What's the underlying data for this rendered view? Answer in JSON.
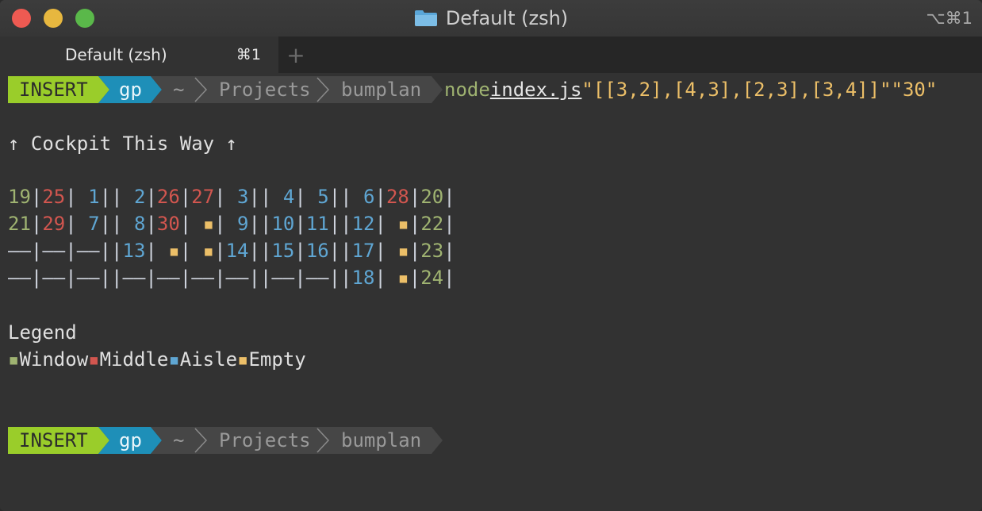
{
  "window": {
    "title": "Default (zsh)",
    "shortcut": "⌥⌘1"
  },
  "tab": {
    "label": "Default (zsh)",
    "shortcut": "⌘1",
    "add": "+"
  },
  "prompt": {
    "mode": "INSERT",
    "user": "gp",
    "home": "~",
    "dir1": "Projects",
    "dir2": "bumplan"
  },
  "command": {
    "program": "node",
    "file": "index.js",
    "arg1": "\"[[3,2],[4,3],[2,3],[3,4]]\"",
    "arg2": "\"30\""
  },
  "output": {
    "heading": "↑ Cockpit This Way ↑",
    "legend_title": "Legend",
    "legend": {
      "window": "Window",
      "middle": "Middle",
      "aisle": "Aisle",
      "empty": "Empty"
    }
  },
  "colors": {
    "window": "#9fb371",
    "middle": "#d2564f",
    "aisle": "#5fa6d3",
    "empty": "#ecbf68",
    "insert": "#9acd2a",
    "user": "#1e8fb8"
  }
}
